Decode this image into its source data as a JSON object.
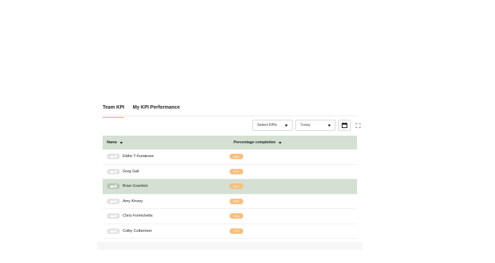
{
  "tabs": [
    {
      "label": "Team KPI",
      "active": true
    },
    {
      "label": "My KPI Performance",
      "active": false
    }
  ],
  "controls": {
    "kpi_select_value": "Select KPIs",
    "date_select_value": "Today",
    "calendar_icon": "calendar-icon",
    "expand_icon": "expand-icon"
  },
  "table": {
    "headers": {
      "name": "Name",
      "percentage": "Percentage completion"
    },
    "rows": [
      {
        "name": "Eldho T Kuriakose",
        "percent": "85%",
        "highlight": false
      },
      {
        "name": "Greg Gall",
        "percent": "67%",
        "highlight": false
      },
      {
        "name": "Brian Gramlich",
        "percent": "82%",
        "highlight": true
      },
      {
        "name": "Amy Kinsey",
        "percent": "60%",
        "highlight": false
      },
      {
        "name": "Chris Formichella",
        "percent": "76%",
        "highlight": false
      },
      {
        "name": "Colby Culbertson",
        "percent": "74%",
        "highlight": false
      }
    ]
  },
  "colors": {
    "accent": "#f2a14a",
    "header_bg": "#d3e0d2",
    "highlight_row_bg": "#d3e0d2",
    "badge_bg": "#f6c084"
  }
}
